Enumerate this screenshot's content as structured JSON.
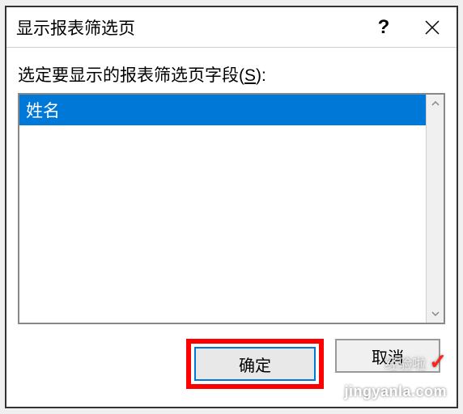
{
  "dialog": {
    "title": "显示报表筛选页",
    "help_symbol": "?",
    "field_label_prefix": "选定要显示的报表筛选页字段(",
    "field_label_key": "S",
    "field_label_suffix": "):",
    "list_items": [
      "姓名"
    ],
    "buttons": {
      "ok": "确定",
      "cancel": "取消"
    }
  },
  "watermark": {
    "label": "经验啦",
    "url": "jingyanla.com",
    "check": "✓"
  }
}
